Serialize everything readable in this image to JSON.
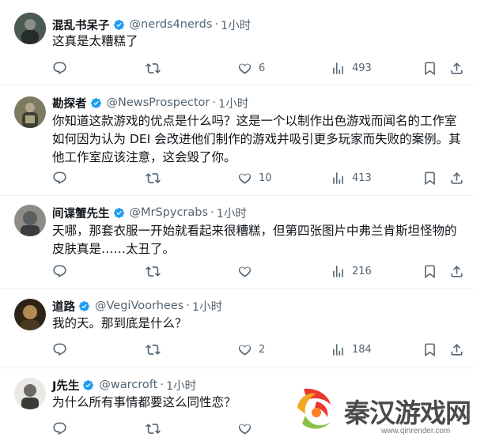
{
  "tweets": [
    {
      "name": "混乱书呆子",
      "handle": "@nerds4nerds",
      "dot": "·",
      "time": "1小时",
      "text": "这真是太糟糕了",
      "replies": "",
      "retweets": "",
      "likes": "6",
      "views": "493"
    },
    {
      "name": "勘探者",
      "handle": "@NewsProspector",
      "dot": "·",
      "time": "1小时",
      "text": "你知道这款游戏的优点是什么吗？这是一个以制作出色游戏而闻名的工作室如何因为认为 DEI 会改进他们制作的游戏并吸引更多玩家而失败的案例。其他工作室应该注意，这会毁了你。",
      "replies": "",
      "retweets": "",
      "likes": "10",
      "views": "413"
    },
    {
      "name": "间谍蟹先生",
      "handle": "@MrSpycrabs",
      "dot": "·",
      "time": "1小时",
      "text": "天哪，那套衣服一开始就看起来很糟糕，但第四张图片中弗兰肯斯坦怪物的皮肤真是……太丑了。",
      "replies": "",
      "retweets": "",
      "likes": "",
      "views": "216"
    },
    {
      "name": "道路",
      "handle": "@VegiVoorhees",
      "dot": "·",
      "time": "1小时",
      "text": "我的天。那到底是什么？",
      "replies": "",
      "retweets": "",
      "likes": "2",
      "views": "184"
    },
    {
      "name": "J先生",
      "handle": "@warcroft",
      "dot": "·",
      "time": "1小时",
      "text": "为什么所有事情都要这么同性恋？",
      "replies": "",
      "retweets": "",
      "likes": "",
      "views": ""
    }
  ],
  "icons": {
    "reply": "reply-icon",
    "retweet": "retweet-icon",
    "like": "heart-icon",
    "views": "views-icon",
    "bookmark": "bookmark-icon",
    "share": "share-icon",
    "verified": "verified-badge-icon"
  },
  "colors": {
    "verified": "#1d9bf0",
    "secondary_text": "#536471",
    "divider": "#eff3f4"
  },
  "watermark": {
    "text": "秦汉游戏网",
    "url": "www.qinrender.com"
  }
}
